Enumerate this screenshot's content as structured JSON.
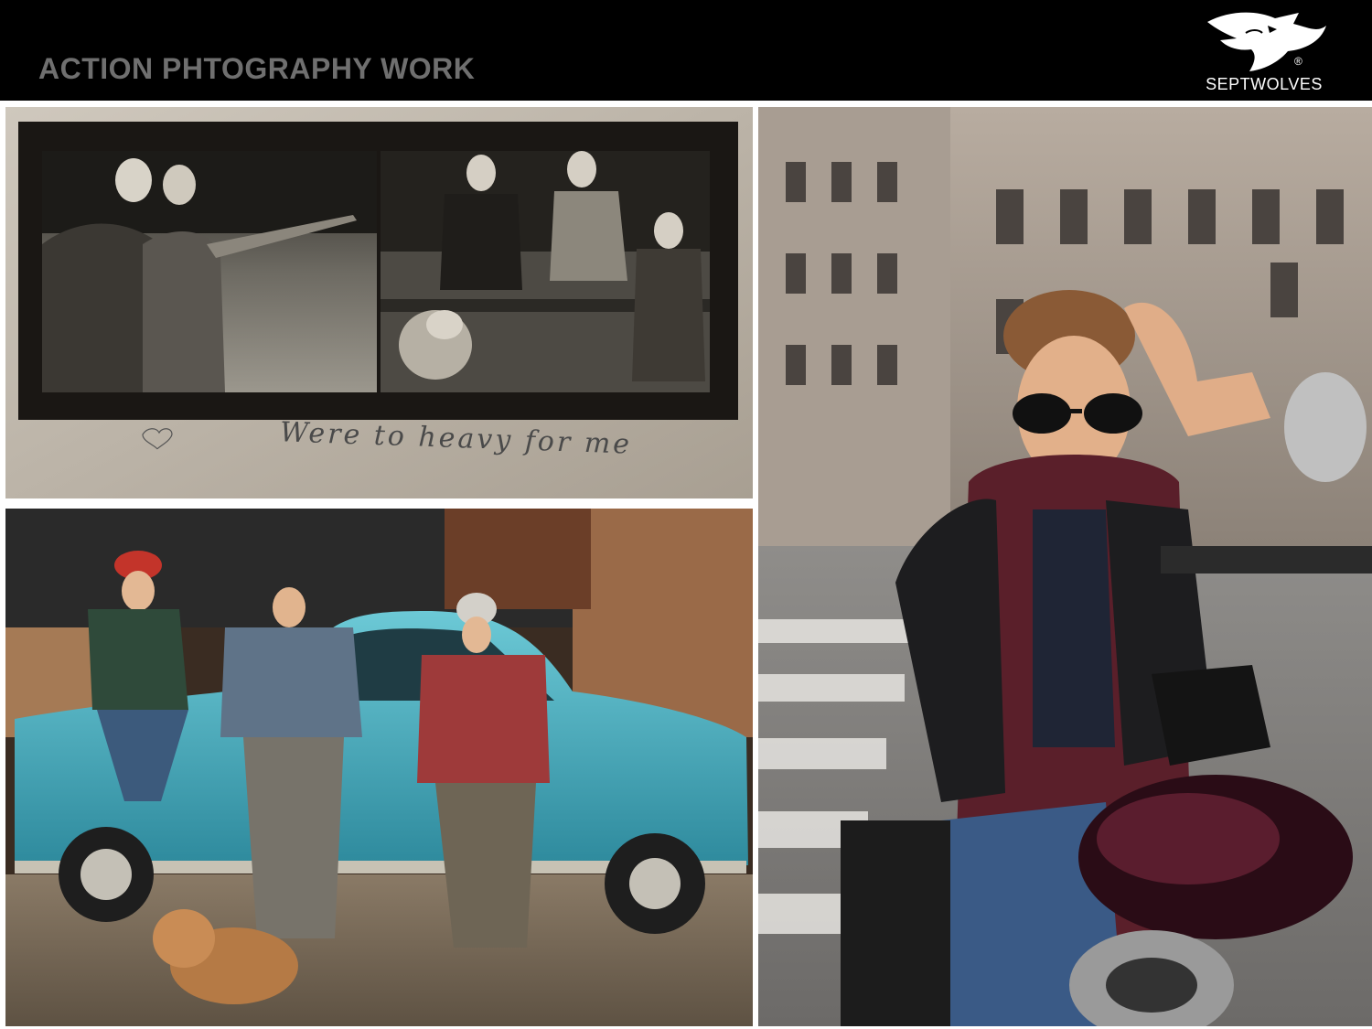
{
  "header": {
    "title": "ACTION PHTOGRAPHY WORK",
    "background": "#000000",
    "title_color": "#6f6f6f"
  },
  "logo": {
    "brand": "SEPTWOLVES",
    "registered_mark": "®",
    "icon": "wolf-head-icon"
  },
  "photos": [
    {
      "name": "vintage-bw-couple-friends-dog-photo",
      "caption": "Were to heavy for me"
    },
    {
      "name": "teal-vintage-car-group-with-bulldog-photo"
    },
    {
      "name": "motorcycle-man-sunglasses-photo"
    }
  ]
}
